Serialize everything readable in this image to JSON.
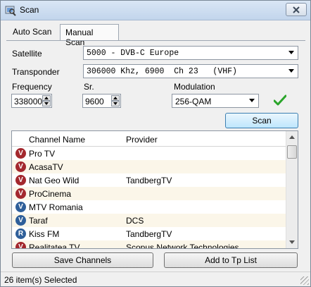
{
  "window": {
    "title": "Scan"
  },
  "tabs": {
    "auto": "Auto Scan",
    "manual": "Manual Scan"
  },
  "form": {
    "satellite_label": "Satellite",
    "satellite_value": "5000 - DVB-C Europe",
    "transponder_label": "Transponder",
    "transponder_value": "306000 Khz, 6900  Ch 23   (VHF)",
    "frequency_label": "Frequency",
    "frequency_value": "338000",
    "sr_label": "Sr.",
    "sr_value": "9600",
    "modulation_label": "Modulation",
    "modulation_value": "256-QAM",
    "scan_button": "Scan"
  },
  "list": {
    "col_channel": "Channel Name",
    "col_provider": "Provider",
    "rows": [
      {
        "icon": "red-v-icon",
        "name": "Pro TV",
        "provider": ""
      },
      {
        "icon": "red-v-icon",
        "name": "AcasaTV",
        "provider": ""
      },
      {
        "icon": "red-v-icon",
        "name": "Nat Geo Wild",
        "provider": "TandbergTV"
      },
      {
        "icon": "red-v-icon",
        "name": "ProCinema",
        "provider": ""
      },
      {
        "icon": "blue-v-icon",
        "name": "MTV Romania",
        "provider": ""
      },
      {
        "icon": "blue-v-icon",
        "name": "Taraf",
        "provider": "DCS"
      },
      {
        "icon": "blue-r-icon",
        "name": "Kiss FM",
        "provider": "TandbergTV"
      },
      {
        "icon": "red-v-icon",
        "name": "Realitatea TV",
        "provider": "Scopus Network Technologies"
      }
    ]
  },
  "buttons": {
    "save": "Save Channels",
    "add": "Add to Tp List"
  },
  "status": {
    "text": "26 item(s) Selected"
  },
  "colors": {
    "red_icon": "#a3282e",
    "blue_icon": "#2f5f9a",
    "check": "#2aa52a"
  }
}
